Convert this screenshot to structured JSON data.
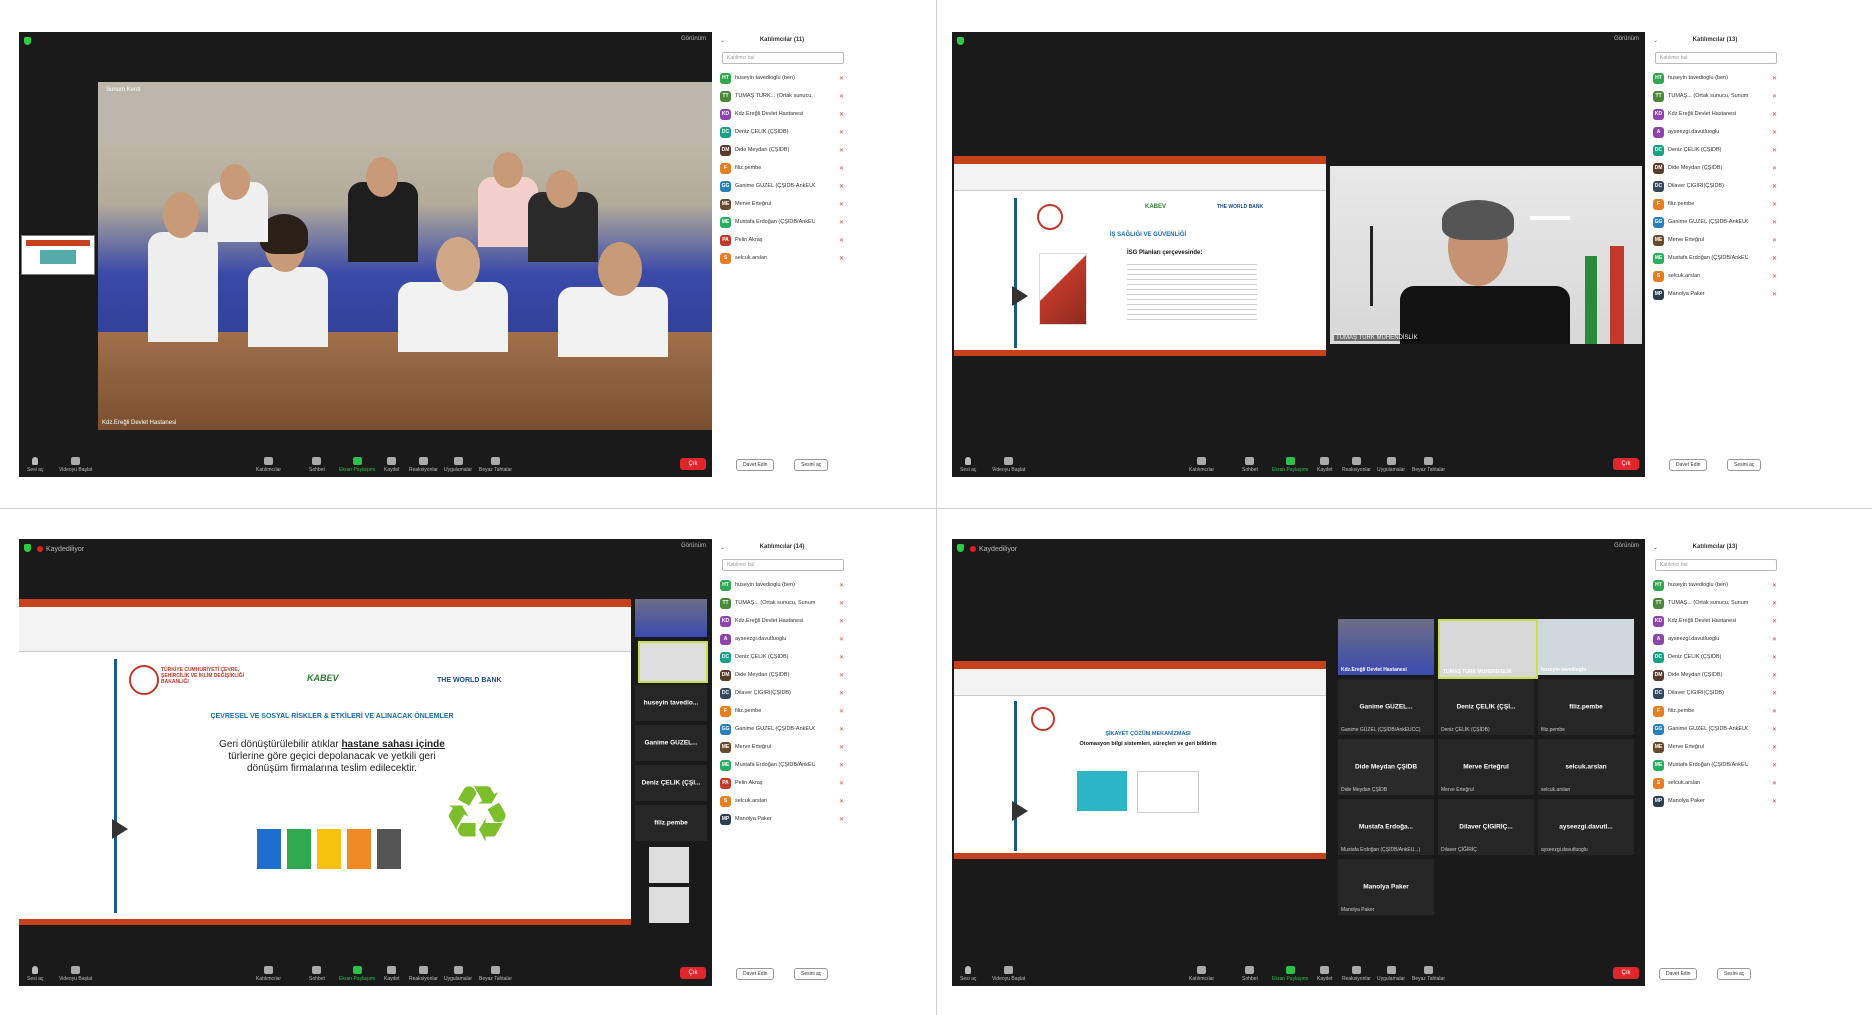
{
  "common": {
    "recording": "Kaydediliyor",
    "view_button": "Görünüm",
    "end_button": "Çık",
    "search_placeholder": "Katılımcı bul",
    "panel_mute_all": "Davet Edin",
    "panel_more": "Sesini aç",
    "toolbar": {
      "mute": "Sesi aç",
      "video": "Videoyu Başlat",
      "participants": "Katılımcılar",
      "chat": "Sohbet",
      "share": "Ekran Paylaşımı",
      "record": "Kaydet",
      "reactions": "Reaksiyonlar",
      "apps": "Uygulamalar",
      "whiteboard": "Beyaz Tahtalar"
    }
  },
  "q1": {
    "panel_title": "Katılımcılar (11)",
    "speaker_label": "Kdz.Ereğli Devlet Hastanesi",
    "active_label": "Sunum Kenti",
    "participants": [
      {
        "initials": "HT",
        "color": "#2fa84f",
        "name": "huseyin tavedioglu (ben)"
      },
      {
        "initials": "TT",
        "color": "#4a8a3a",
        "name": "TÜMAŞ TÜRK... (Ortak sunucu, Sunum Sahibi)"
      },
      {
        "initials": "KD",
        "color": "#8e44ad",
        "name": "Kdz.Ereğli Devlet Hastanesi"
      },
      {
        "initials": "DC",
        "color": "#16a085",
        "name": "Deniz ÇELİK (ÇŞİDB)"
      },
      {
        "initials": "DM",
        "color": "#5b3b2b",
        "name": "Dide Meydan (ÇŞİDB)"
      },
      {
        "initials": "F",
        "color": "#e67e22",
        "name": "filiz.pembe"
      },
      {
        "initials": "GG",
        "color": "#2980b9",
        "name": "Ganime GÜZEL (ÇŞİDB-AnkEUCC)"
      },
      {
        "initials": "ME",
        "color": "#6b4a2b",
        "name": "Merve Erteğrul"
      },
      {
        "initials": "ME",
        "color": "#27ae60",
        "name": "Mustafa Erdoğan (ÇŞİDB/AnkEU...)"
      },
      {
        "initials": "PA",
        "color": "#c0392b",
        "name": "Pelin Akraş"
      },
      {
        "initials": "S",
        "color": "#e67e22",
        "name": "selcuk.arslan"
      }
    ]
  },
  "q2": {
    "panel_title": "Katılımcılar (13)",
    "speaker_label": "TÜMAŞ TÜRK MÜHENDİSLİK",
    "slide_title": "İŞ SAĞLIĞI VE GÜVENLİĞİ",
    "slide_subtitle": "İSG Planları çerçevesinde:",
    "kabev": "KABEV",
    "worldbank": "THE WORLD BANK",
    "participants": [
      {
        "initials": "HT",
        "color": "#2fa84f",
        "name": "huseyin tavedioglu (ben)"
      },
      {
        "initials": "TT",
        "color": "#4a8a3a",
        "name": "TÜMAŞ... (Ortak sunucu, Sunum Sahibi)"
      },
      {
        "initials": "KD",
        "color": "#8e44ad",
        "name": "Kdz.Ereğli Devlet Hastanesi"
      },
      {
        "initials": "A",
        "color": "#8e44ad",
        "name": "ayseezgi.davutluoglu"
      },
      {
        "initials": "DC",
        "color": "#16a085",
        "name": "Deniz ÇELİK (ÇŞİDB)"
      },
      {
        "initials": "DM",
        "color": "#5b3b2b",
        "name": "Dide Meydan (ÇŞİDB)"
      },
      {
        "initials": "DC",
        "color": "#34495e",
        "name": "Dilaver ÇİĞİRİ(ÇŞİDB)"
      },
      {
        "initials": "F",
        "color": "#e67e22",
        "name": "filiz.pembe"
      },
      {
        "initials": "GG",
        "color": "#2980b9",
        "name": "Ganime GÜZEL (ÇŞİDB-AnkEUCC)"
      },
      {
        "initials": "ME",
        "color": "#6b4a2b",
        "name": "Merve Erteğrul"
      },
      {
        "initials": "ME",
        "color": "#27ae60",
        "name": "Mustafa Erdoğan (ÇŞİDB/AnkEU...)"
      },
      {
        "initials": "S",
        "color": "#e67e22",
        "name": "selcuk.arslan"
      },
      {
        "initials": "MP",
        "color": "#2c3e50",
        "name": "Manolya Paker"
      }
    ]
  },
  "q3": {
    "panel_title": "Katılımcılar (14)",
    "slide_title": "ÇEVRESEL VE SOSYAL RİSKLER & ETKİLERİ VE ALINACAK ÖNLEMLER",
    "slide_text_1": "Geri dönüştürülebilir atıklar ",
    "slide_text_bold": "hastane sahası içinde",
    "slide_text_2": "türlerine göre geçici depolanacak ve yetkili geri dönüşüm firmalarına teslim edilecektir.",
    "ministry": "TÜRKİYE CUMHURİYETİ ÇEVRE, ŞEHİRCİLİK VE İKLİM DEĞİŞİKLİĞİ BAKANLIĞI",
    "kabev": "KABEV",
    "worldbank": "THE WORLD BANK",
    "side_tiles": [
      "huseyin tavedio...",
      "Ganime GÜZEL...",
      "Deniz ÇELİK (ÇŞİ...",
      "filiz.pembe"
    ],
    "participants": [
      {
        "initials": "HT",
        "color": "#2fa84f",
        "name": "huseyin tavedioglu (ben)"
      },
      {
        "initials": "TT",
        "color": "#4a8a3a",
        "name": "TÜMAŞ... (Ortak sunucu, Sunum Sahibi)"
      },
      {
        "initials": "KD",
        "color": "#8e44ad",
        "name": "Kdz.Ereğli Devlet Hastanesi"
      },
      {
        "initials": "A",
        "color": "#8e44ad",
        "name": "ayseezgi.davutluoglu"
      },
      {
        "initials": "DC",
        "color": "#16a085",
        "name": "Deniz ÇELİK (ÇŞİDB)"
      },
      {
        "initials": "DM",
        "color": "#5b3b2b",
        "name": "Dide Meydan (ÇŞİDB)"
      },
      {
        "initials": "DC",
        "color": "#34495e",
        "name": "Dilaver ÇİĞİRİ(ÇŞİDB)"
      },
      {
        "initials": "F",
        "color": "#e67e22",
        "name": "filiz.pembe"
      },
      {
        "initials": "GG",
        "color": "#2980b9",
        "name": "Ganime GÜZEL (ÇŞİDB-AnkEUCC)"
      },
      {
        "initials": "ME",
        "color": "#6b4a2b",
        "name": "Merve Erteğrul"
      },
      {
        "initials": "ME",
        "color": "#27ae60",
        "name": "Mustafa Erdoğan (ÇŞİDB/AnkEU...)"
      },
      {
        "initials": "PA",
        "color": "#c0392b",
        "name": "Pelin Akraş"
      },
      {
        "initials": "S",
        "color": "#e67e22",
        "name": "selcuk.arslan"
      },
      {
        "initials": "MP",
        "color": "#2c3e50",
        "name": "Manolya Paker"
      }
    ]
  },
  "q4": {
    "panel_title": "Katılımcılar (13)",
    "slide_title": "ŞİKAYET ÇÖZÜM MEKANİZMASI",
    "slide_subtitle": "Otomasyon bilgi sistemleri, süreçleri ve geri bildirim",
    "tiles": [
      {
        "name": "Kdz.Ereğli Devlet Hastanesi",
        "label": ""
      },
      {
        "name": "TÜMAŞ TÜRK MÜHENDİSLİK",
        "label": ""
      },
      {
        "name": "huseyin tavedioglu",
        "label": ""
      },
      {
        "name": "Ganime GÜZEL...",
        "label": "Ganime GÜZEL (ÇŞİDB/AnkEUCC)"
      },
      {
        "name": "Deniz ÇELİK (ÇŞİ...",
        "label": "Deniz ÇELİK (ÇŞİDB)"
      },
      {
        "name": "filiz.pembe",
        "label": "filiz.pembe"
      },
      {
        "name": "Dide Meydan ÇŞİDB",
        "label": "Dide Meydan ÇŞİDB"
      },
      {
        "name": "Merve Erteğrul",
        "label": "Merve Erteğrul"
      },
      {
        "name": "selcuk.arslan",
        "label": "selcuk.arslan"
      },
      {
        "name": "Mustafa Erdoğa...",
        "label": "Mustafa Erdoğan (ÇŞİDB/AnkEU...)"
      },
      {
        "name": "Dilaver ÇİĞİRİÇ...",
        "label": "Dilaver ÇİĞİRİÇ"
      },
      {
        "name": "ayseezgi.davutl...",
        "label": "ayseezgi.davutluoglu"
      },
      {
        "name": "Manolya Paker",
        "label": "Manolya Paker"
      }
    ],
    "participants": [
      {
        "initials": "HT",
        "color": "#2fa84f",
        "name": "huseyin tavedioglu (ben)"
      },
      {
        "initials": "TT",
        "color": "#4a8a3a",
        "name": "TÜMAŞ... (Ortak sunucu, Sunum Sahibi)"
      },
      {
        "initials": "KD",
        "color": "#8e44ad",
        "name": "Kdz.Ereğli Devlet Hastanesi"
      },
      {
        "initials": "A",
        "color": "#8e44ad",
        "name": "ayseezgi.davutluoglu"
      },
      {
        "initials": "DC",
        "color": "#16a085",
        "name": "Deniz ÇELİK (ÇŞİDB)"
      },
      {
        "initials": "DM",
        "color": "#5b3b2b",
        "name": "Dide Meydan (ÇŞİDB)"
      },
      {
        "initials": "DC",
        "color": "#34495e",
        "name": "Dilaver ÇİĞİRİ(ÇŞİDB)"
      },
      {
        "initials": "F",
        "color": "#e67e22",
        "name": "filiz.pembe"
      },
      {
        "initials": "GG",
        "color": "#2980b9",
        "name": "Ganime GÜZEL (ÇŞİDB-AnkEUCC)"
      },
      {
        "initials": "ME",
        "color": "#6b4a2b",
        "name": "Merve Erteğrul"
      },
      {
        "initials": "ME",
        "color": "#27ae60",
        "name": "Mustafa Erdoğan (ÇŞİDB/AnkEU...)"
      },
      {
        "initials": "S",
        "color": "#e67e22",
        "name": "selcuk.arslan"
      },
      {
        "initials": "MP",
        "color": "#2c3e50",
        "name": "Manolya Paker"
      }
    ]
  }
}
